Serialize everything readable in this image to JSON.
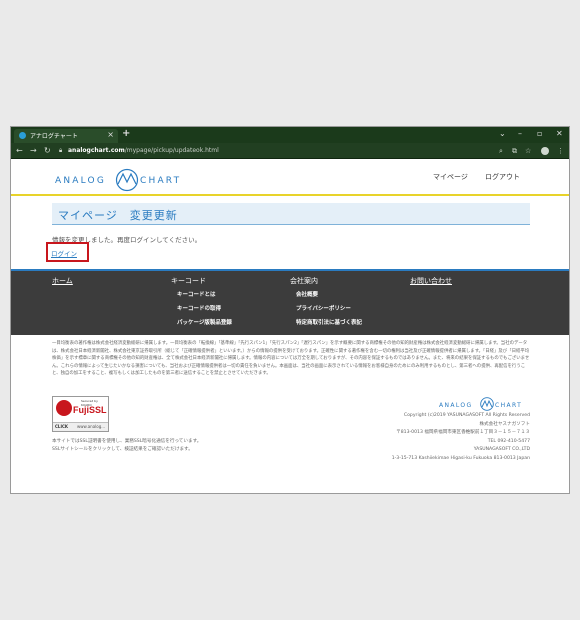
{
  "browser": {
    "tab_title": "アナログチャート",
    "tab_close": "×",
    "new_tab": "+",
    "url_host": "analogchart.com",
    "url_path": "/mypage/pickup/updateok.html"
  },
  "header": {
    "logo_left": "ANALOG",
    "logo_right": "CHART",
    "nav": [
      "マイページ",
      "ログアウト"
    ]
  },
  "main": {
    "title": "マイページ　変更更新",
    "message": "情報を変更しました。再度ログインしてください。",
    "login_link": "ログイン"
  },
  "footer": {
    "columns": [
      {
        "heading": "ホーム",
        "links": []
      },
      {
        "heading": "キーコード",
        "links": [
          "キーコードとは",
          "キーコードの取得",
          "パッケージ版製品登録"
        ]
      },
      {
        "heading": "会社案内",
        "links": [
          "会社概要",
          "プライバシーポリシー",
          "特定商取引法に基づく表記"
        ]
      },
      {
        "heading": "お問い合わせ",
        "links": []
      }
    ],
    "disclaimer": "一目均衡表の著作権は株式会社経済変動総研に帰属します。一目均衡表の「転換線」「基準線」「先行スパン1」「先行スパン2」「遅行スパン」を示す概要に関する商標権その他の知的財産権は株式会社経済変動総研に帰属します。当社のデータは、株式会社日本経済新聞社、株式会社東京証券取引所（総じて「正確情報提供者」といいます。）からの情報の提供を受けております。正確性に関する著作権を含む一切の権利は当社及び正確情報提供者に帰属します。「日経」及び「日経平均株価」を示す標章に関する商標権その他の知的財産権は、全て株式会社日本経済新聞社に帰属します。情報の内容については万全を期しておりますが、その内容を保証するものではありません。また、将来の結果を保証するものでもございません。これらの情報によって生じたいかなる損害についても、当社および正確情報提供者は一切の責任を負いません。本画面は、当社の画面に表示されている情報をお客様自身のためにのみ利用するものとし、第三者への提供、再配信を行うこと、独自の加工をすること、複写もしくは加工したものを第三者に送信することを禁止とさせていただきます。",
    "ssl": {
      "secured_by": "Secured by KUARO",
      "brand": "FujiSSL",
      "click": "CLICK",
      "www": "www.analog..."
    },
    "ssl_note": [
      "本サイトではSSL証明書を使用し、業務SSL暗号化通信を行っています。",
      "SSLサイトシールをクリックして、検証結果をご確認いただけます。"
    ],
    "logo_left": "ANALOG",
    "logo_right": "CHART",
    "address_lines": [
      "Copyright (c)2019 YASUNAGASOFT All Rights Reserved",
      "株式会社ヤスナガソフト",
      "〒813-0013 福岡県福岡市東区香椎駅前１丁目３－１５－７１３",
      "TEL 092-410-5477",
      "YASUNAGASOFT CO.,LTD",
      "1-3-15-713 Kashiiekimae Higasi-ku Fukuoka 813-0013 Japan"
    ]
  },
  "colors": {
    "brand_blue": "#2a7bc0",
    "accent_yellow": "#e8d32a",
    "highlight_red": "#c8161d",
    "footer_dark": "#3c3c3c"
  }
}
